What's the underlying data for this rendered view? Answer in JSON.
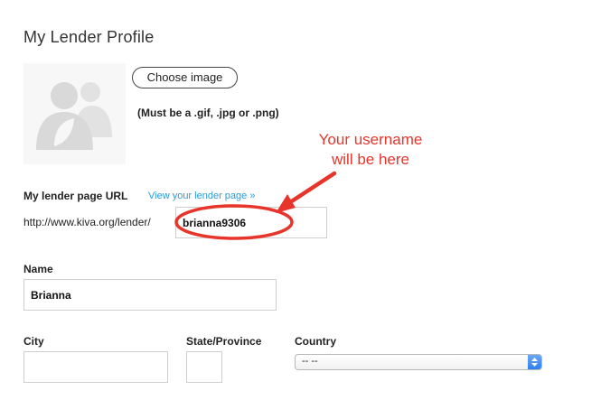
{
  "header": {
    "title": "My Lender Profile"
  },
  "profile_image": {
    "choose_label": "Choose image",
    "hint": "(Must be a .gif, .jpg or .png)",
    "placeholder_icon": "default-avatar-icon"
  },
  "annotation": {
    "line1": "Your username",
    "line2": "will be here",
    "color": "#e8352b"
  },
  "lender_url": {
    "label": "My lender page URL",
    "link_text": "View your lender page »",
    "prefix": "http://www.kiva.org/lender/",
    "value": "brianna9306",
    "link_color": "#2b9bd6"
  },
  "name": {
    "label": "Name",
    "value": "Brianna"
  },
  "city": {
    "label": "City",
    "value": ""
  },
  "state": {
    "label": "State/Province",
    "value": ""
  },
  "country": {
    "label": "Country",
    "selected": "-- --",
    "arrow_icon": "select-updown-arrows-icon"
  }
}
